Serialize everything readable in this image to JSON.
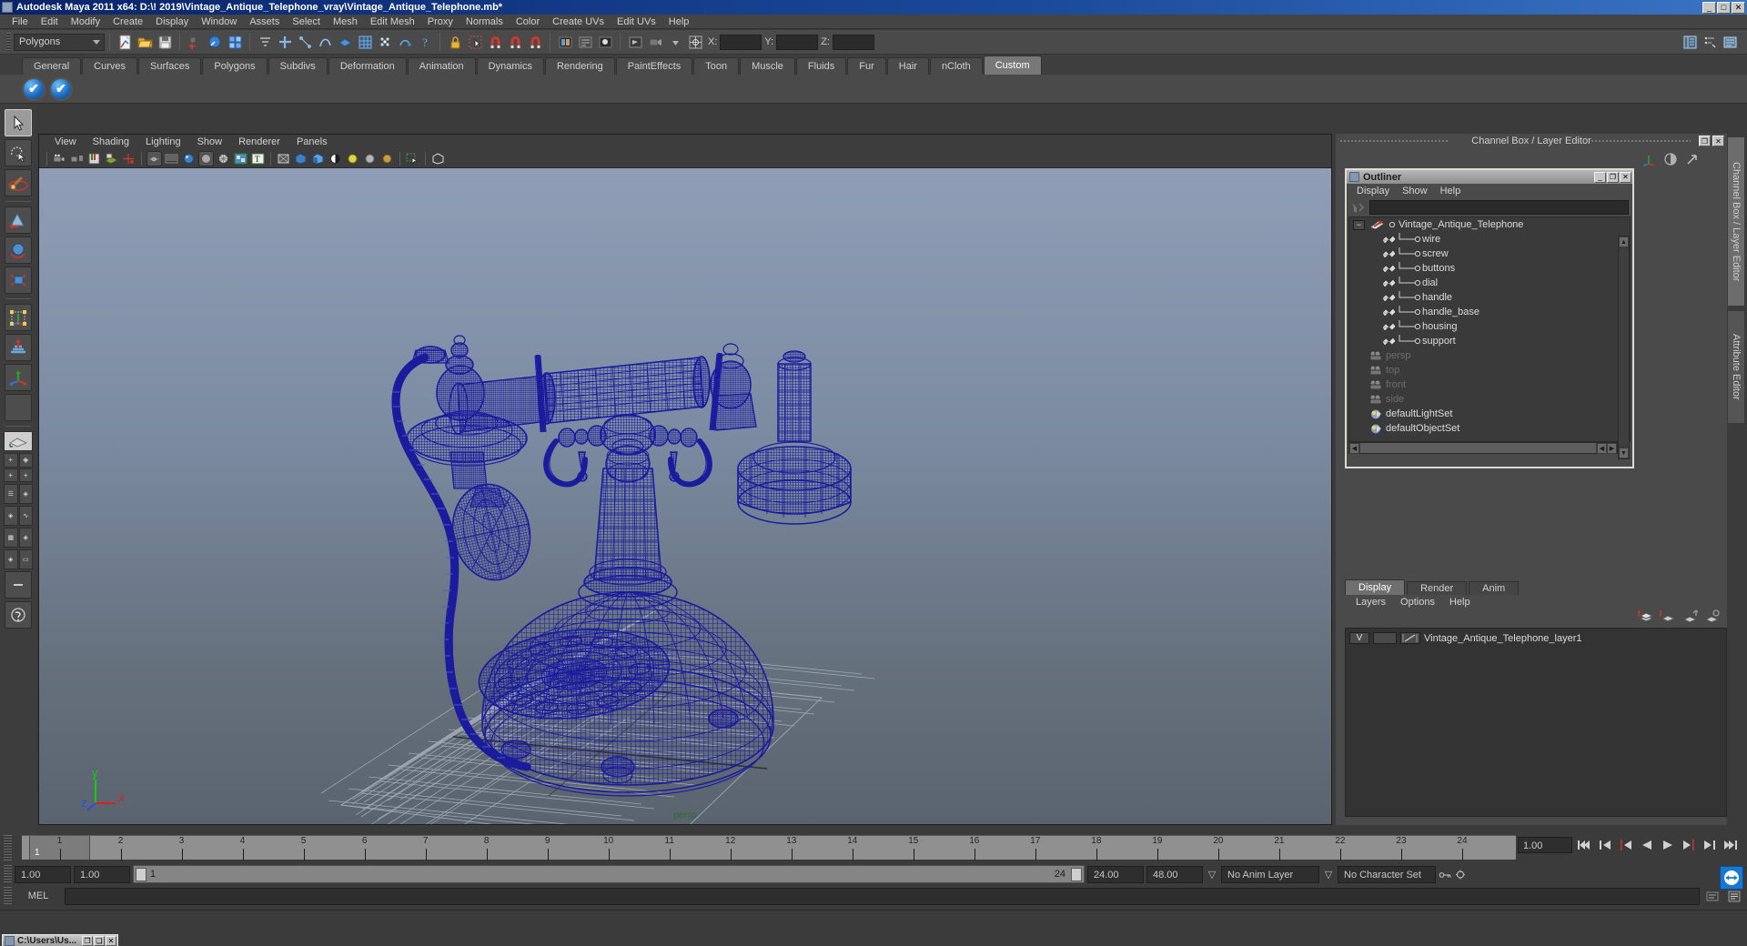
{
  "window": {
    "title": "Autodesk Maya 2011 x64: D:\\! 2019\\Vintage_Antique_Telephone_vray\\Vintage_Antique_Telephone.mb*",
    "minimize": "_",
    "maximize": "□",
    "close": "✕"
  },
  "menubar": {
    "items": [
      "File",
      "Edit",
      "Modify",
      "Create",
      "Display",
      "Window",
      "Assets",
      "Select",
      "Mesh",
      "Edit Mesh",
      "Proxy",
      "Normals",
      "Color",
      "Create UVs",
      "Edit UVs",
      "Help"
    ]
  },
  "toolbar": {
    "menu_set": "Polygons",
    "coord_labels": [
      "X:",
      "Y:",
      "Z:"
    ],
    "coord_values": [
      "",
      "",
      ""
    ]
  },
  "shelf": {
    "tabs": [
      "General",
      "Curves",
      "Surfaces",
      "Polygons",
      "Subdivs",
      "Deformation",
      "Animation",
      "Dynamics",
      "Rendering",
      "PaintEffects",
      "Toon",
      "Muscle",
      "Fluids",
      "Fur",
      "Hair",
      "nCloth",
      "Custom"
    ],
    "active_tab": "Custom",
    "buttons": [
      "check-shelf-item-1",
      "check-shelf-item-2"
    ]
  },
  "toolbox": {
    "items": [
      {
        "name": "select-tool",
        "selected": true
      },
      {
        "name": "lasso-select-tool",
        "selected": false
      },
      {
        "name": "paint-select-tool",
        "selected": false
      },
      {
        "name": "move-tool",
        "selected": false
      },
      {
        "name": "rotate-tool",
        "selected": false
      },
      {
        "name": "scale-tool",
        "selected": false
      },
      {
        "name": "universal-manipulator",
        "selected": false
      },
      {
        "name": "soft-modification-tool",
        "selected": false
      },
      {
        "name": "last-tool-used",
        "selected": false
      },
      {
        "name": "blank-slot",
        "selected": false
      }
    ]
  },
  "viewport": {
    "menus": [
      "View",
      "Shading",
      "Lighting",
      "Show",
      "Renderer",
      "Panels"
    ],
    "axis": {
      "x": "x",
      "y": "y",
      "z": "z"
    },
    "hud_label": "persp",
    "model": "Vintage_Antique_Telephone",
    "wireframe_color": "#1b1b9e",
    "background_top": "#8d9cb3",
    "background_bottom": "#5a646f"
  },
  "channel_box": {
    "title": "Channel Box / Layer Editor",
    "restore": "❐",
    "close": "✕"
  },
  "outliner": {
    "title": "Outliner",
    "minimize": "_",
    "maximize": "❐",
    "close": "✕",
    "menus": [
      "Display",
      "Show",
      "Help"
    ],
    "search_value": "",
    "rows": [
      {
        "label": "Vintage_Antique_Telephone",
        "type": "group",
        "indent": 0,
        "dim": false,
        "expander": "−"
      },
      {
        "label": "wire",
        "type": "mesh",
        "indent": 1,
        "dim": false
      },
      {
        "label": "screw",
        "type": "mesh",
        "indent": 1,
        "dim": false
      },
      {
        "label": "buttons",
        "type": "mesh",
        "indent": 1,
        "dim": false
      },
      {
        "label": "dial",
        "type": "mesh",
        "indent": 1,
        "dim": false
      },
      {
        "label": "handle",
        "type": "mesh",
        "indent": 1,
        "dim": false
      },
      {
        "label": "handle_base",
        "type": "mesh",
        "indent": 1,
        "dim": false
      },
      {
        "label": "housing",
        "type": "mesh",
        "indent": 1,
        "dim": false
      },
      {
        "label": "support",
        "type": "mesh",
        "indent": 1,
        "dim": false
      },
      {
        "label": "persp",
        "type": "camera",
        "indent": 0,
        "dim": true
      },
      {
        "label": "top",
        "type": "camera",
        "indent": 0,
        "dim": true
      },
      {
        "label": "front",
        "type": "camera",
        "indent": 0,
        "dim": true
      },
      {
        "label": "side",
        "type": "camera",
        "indent": 0,
        "dim": true
      },
      {
        "label": "defaultLightSet",
        "type": "set",
        "indent": 0,
        "dim": false
      },
      {
        "label": "defaultObjectSet",
        "type": "set",
        "indent": 0,
        "dim": false
      }
    ]
  },
  "layer_editor": {
    "tabs": [
      "Display",
      "Render",
      "Anim"
    ],
    "active_tab": "Display",
    "menus": [
      "Layers",
      "Options",
      "Help"
    ],
    "layers": [
      {
        "visibility": "V",
        "shading": "",
        "name": "Vintage_Antique_Telephone_layer1"
      }
    ]
  },
  "right_tabs": {
    "items": [
      "Channel Box / Layer Editor",
      "Attribute Editor"
    ],
    "active": "Channel Box / Layer Editor"
  },
  "timeline": {
    "frames": [
      "1",
      "2",
      "3",
      "4",
      "5",
      "6",
      "7",
      "8",
      "9",
      "10",
      "11",
      "12",
      "13",
      "14",
      "15",
      "16",
      "17",
      "18",
      "19",
      "20",
      "21",
      "22",
      "23",
      "24"
    ],
    "current_frame": "1",
    "current_time_field": "1.00"
  },
  "playback_controls": {
    "buttons": [
      "go-to-start",
      "step-back-key",
      "step-back-frame",
      "play-backwards",
      "play-forwards",
      "step-forward-frame",
      "step-forward-key",
      "go-to-end"
    ],
    "glyphs": [
      "|◀◀",
      "|◀",
      "|◀",
      "◀",
      "▶",
      "▶|",
      "▶|",
      "▶▶|"
    ]
  },
  "range_slider": {
    "anim_start": "1.00",
    "anim_end": "1.00",
    "range_start_label": "1",
    "range_end_label": "24",
    "playback_start": "24.00",
    "playback_end": "48.00",
    "anim_layer": "No Anim Layer",
    "character_set": "No Character Set"
  },
  "command_line": {
    "language": "MEL",
    "value": ""
  },
  "taskbar": {
    "window_title": "C:\\Users\\Us...",
    "restore": "❐",
    "maximize": "❏",
    "close": "✕"
  }
}
